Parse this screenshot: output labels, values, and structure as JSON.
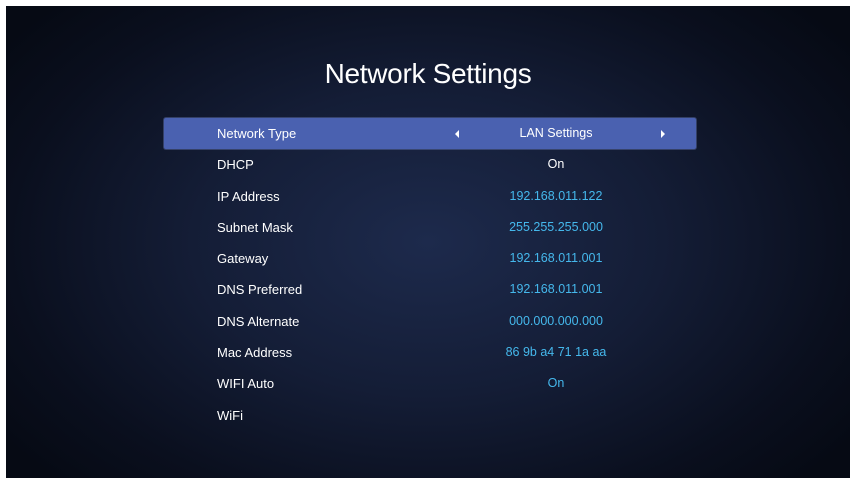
{
  "page": {
    "title": "Network Settings"
  },
  "colors": {
    "selected_row": "#4a61b0",
    "accent_value": "#45b8ec",
    "background": "#141d36"
  },
  "settings": [
    {
      "label": "Network Type",
      "value": "LAN Settings",
      "selected": true,
      "accent": false,
      "icons": [
        "triangle-left-icon",
        "triangle-right-icon"
      ]
    },
    {
      "label": "DHCP",
      "value": "On",
      "selected": false,
      "accent": false
    },
    {
      "label": "IP Address",
      "value": "192.168.011.122",
      "selected": false,
      "accent": true
    },
    {
      "label": "Subnet Mask",
      "value": "255.255.255.000",
      "selected": false,
      "accent": true
    },
    {
      "label": "Gateway",
      "value": "192.168.011.001",
      "selected": false,
      "accent": true
    },
    {
      "label": "DNS Preferred",
      "value": "192.168.011.001",
      "selected": false,
      "accent": true
    },
    {
      "label": "DNS Alternate",
      "value": "000.000.000.000",
      "selected": false,
      "accent": true
    },
    {
      "label": "Mac Address",
      "value": "86 9b a4 71 1a aa",
      "selected": false,
      "accent": true
    },
    {
      "label": "WIFI Auto",
      "value": "On",
      "selected": false,
      "accent": true
    },
    {
      "label": "WiFi",
      "value": "",
      "selected": false,
      "accent": false
    }
  ]
}
